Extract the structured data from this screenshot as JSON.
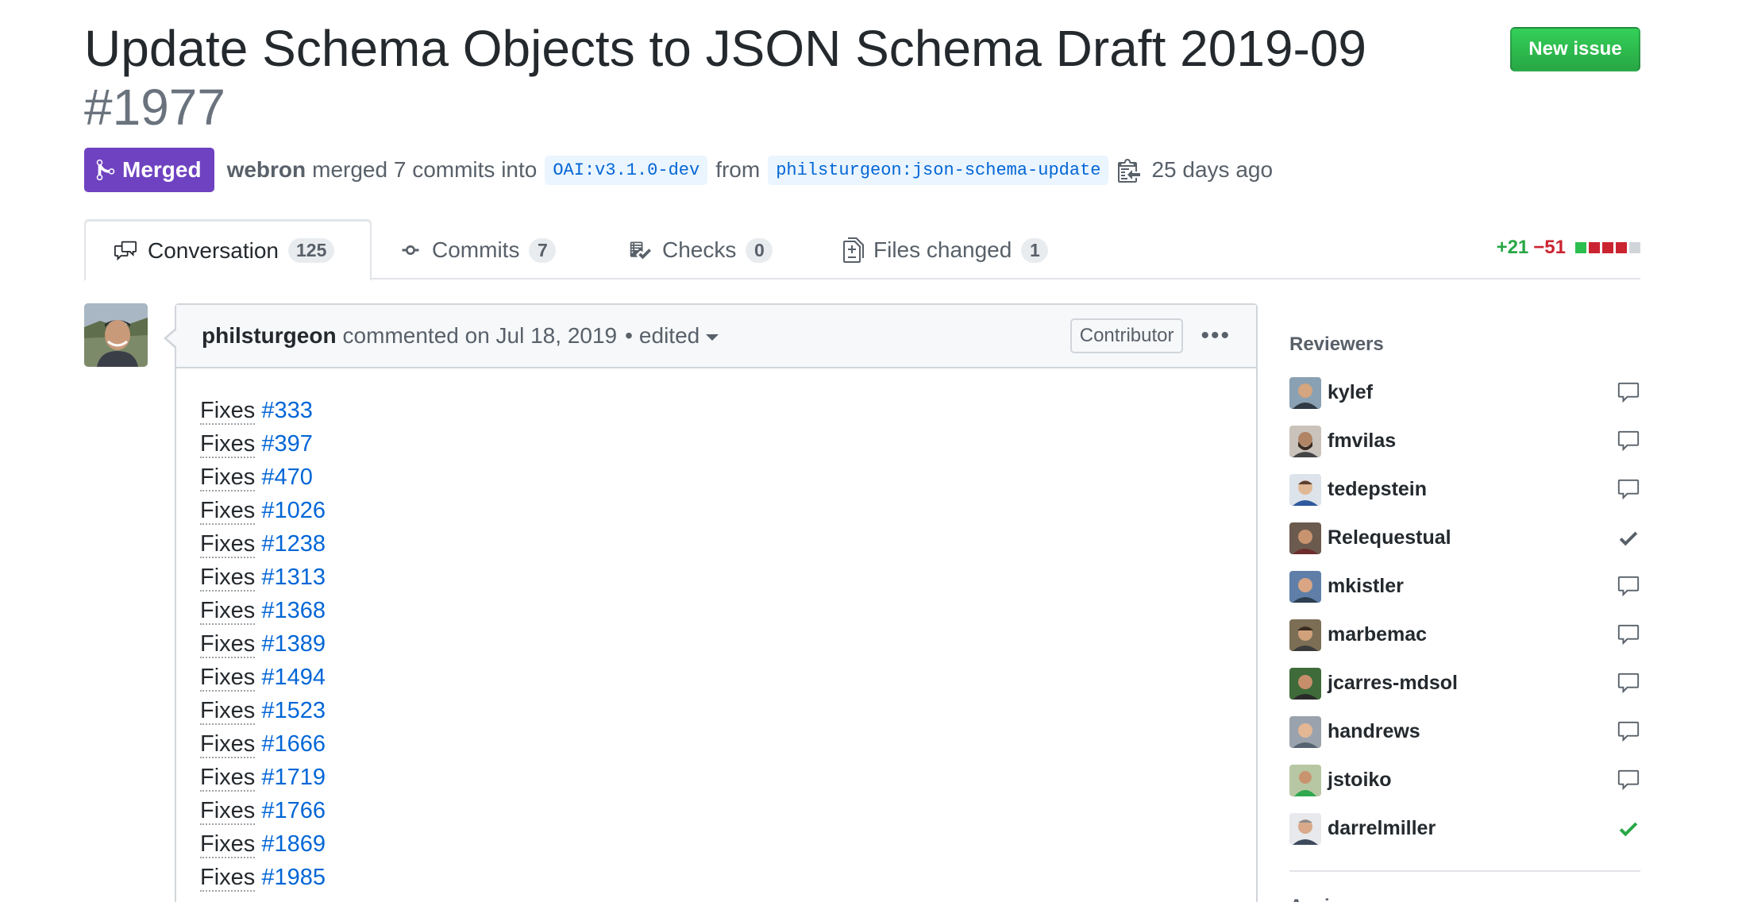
{
  "pr": {
    "title": "Update Schema Objects to JSON Schema Draft 2019-09",
    "number": "#1977",
    "state": "Merged",
    "author": "webron",
    "action": "merged 7 commits into",
    "base_branch": "OAI:v3.1.0-dev",
    "from_text": "from",
    "head_branch": "philsturgeon:json-schema-update",
    "time_ago": "25 days ago"
  },
  "header": {
    "new_issue_label": "New issue"
  },
  "tabs": [
    {
      "label": "Conversation",
      "count": "125"
    },
    {
      "label": "Commits",
      "count": "7"
    },
    {
      "label": "Checks",
      "count": "0"
    },
    {
      "label": "Files changed",
      "count": "1"
    }
  ],
  "diffstat": {
    "additions": "+21",
    "deletions": "−51"
  },
  "comment": {
    "author": "philsturgeon",
    "action": "commented on Jul 18, 2019",
    "separator": "•",
    "edited": "edited",
    "role": "Contributor",
    "more_icon": "kebab-horizontal-icon",
    "fixes": [
      {
        "word": "Fixes",
        "ref": "#333"
      },
      {
        "word": "Fixes",
        "ref": "#397"
      },
      {
        "word": "Fixes",
        "ref": "#470"
      },
      {
        "word": "Fixes",
        "ref": "#1026"
      },
      {
        "word": "Fixes",
        "ref": "#1238"
      },
      {
        "word": "Fixes",
        "ref": "#1313"
      },
      {
        "word": "Fixes",
        "ref": "#1368"
      },
      {
        "word": "Fixes",
        "ref": "#1389"
      },
      {
        "word": "Fixes",
        "ref": "#1494"
      },
      {
        "word": "Fixes",
        "ref": "#1523"
      },
      {
        "word": "Fixes",
        "ref": "#1666"
      },
      {
        "word": "Fixes",
        "ref": "#1719"
      },
      {
        "word": "Fixes",
        "ref": "#1766"
      },
      {
        "word": "Fixes",
        "ref": "#1869"
      },
      {
        "word": "Fixes",
        "ref": "#1985"
      }
    ]
  },
  "sidebar": {
    "reviewers_heading": "Reviewers",
    "reviewers": [
      {
        "name": "kylef",
        "status": "commented"
      },
      {
        "name": "fmvilas",
        "status": "commented"
      },
      {
        "name": "tedepstein",
        "status": "commented"
      },
      {
        "name": "Relequestual",
        "status": "approved-stale"
      },
      {
        "name": "mkistler",
        "status": "commented"
      },
      {
        "name": "marbemac",
        "status": "commented"
      },
      {
        "name": "jcarres-mdsol",
        "status": "commented"
      },
      {
        "name": "handrews",
        "status": "commented"
      },
      {
        "name": "jstoiko",
        "status": "commented"
      },
      {
        "name": "darrelmiller",
        "status": "approved"
      }
    ],
    "assignees_heading": "Assignees"
  },
  "colors": {
    "merged": "#6f42c1",
    "link": "#0366d6",
    "added": "#28a745",
    "deleted": "#cb2431",
    "new_issue": "#2ea44f"
  }
}
